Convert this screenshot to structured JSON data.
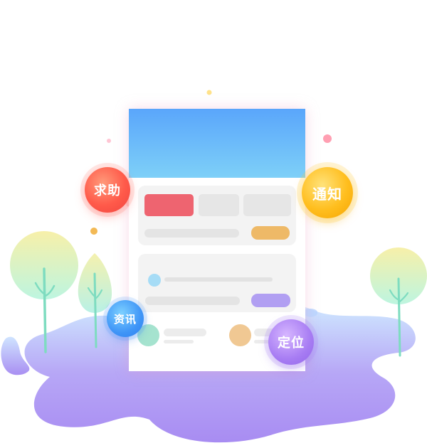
{
  "features": {
    "help": "求助",
    "notice": "通知",
    "news": "资讯",
    "location": "定位"
  },
  "colors": {
    "header": "#5aa6fb",
    "help": "#ff5a4a",
    "notice": "#ffbe1e",
    "news": "#3f95f7",
    "location": "#a77cf3",
    "ground": "#b8a4f5"
  },
  "icons": [
    "help-badge",
    "notice-badge",
    "news-badge",
    "location-badge",
    "tree",
    "phone-mockup"
  ]
}
